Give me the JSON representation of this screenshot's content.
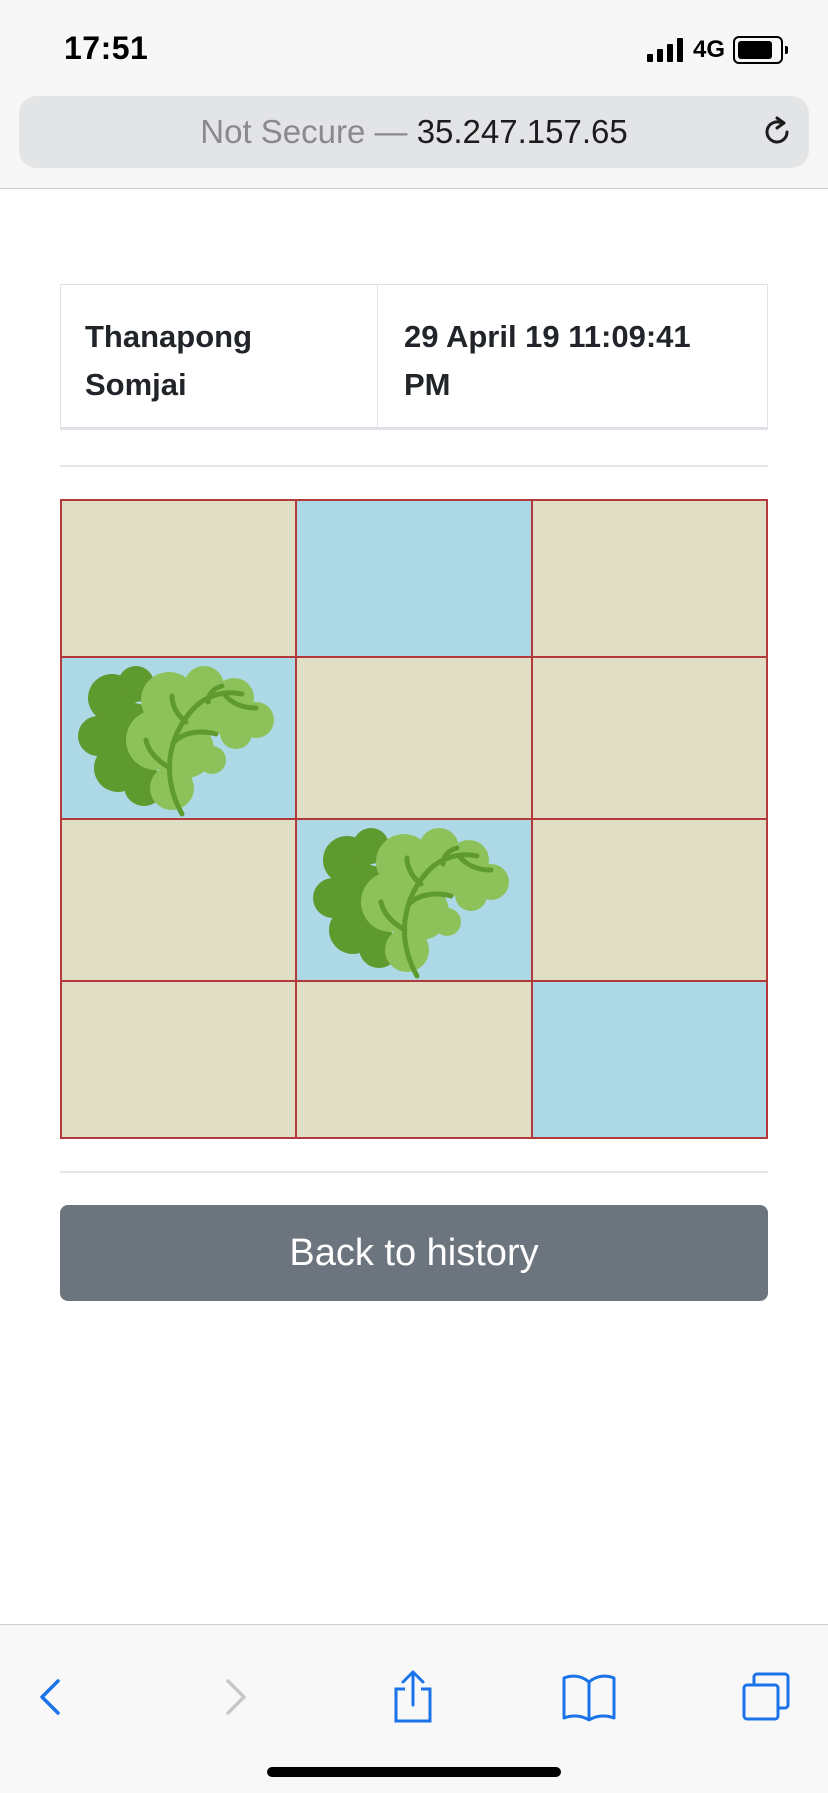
{
  "status_bar": {
    "time": "17:51",
    "network": "4G",
    "icons": [
      "signal-bars-icon",
      "battery-icon"
    ]
  },
  "browser": {
    "security_label": "Not Secure — ",
    "host": "35.247.157.65",
    "reload_icon": "reload-icon"
  },
  "record": {
    "player_name": "Thanapong Somjai",
    "timestamp": "29 April 19 11:09:41 PM"
  },
  "board": {
    "rows": 4,
    "cols": 3,
    "colors": {
      "land": "#e0dfc5",
      "water": "#add8e6",
      "border": "#b23a3a"
    },
    "cells": [
      [
        {
          "tile": "land",
          "item": null
        },
        {
          "tile": "water",
          "item": null
        },
        {
          "tile": "land",
          "item": null
        }
      ],
      [
        {
          "tile": "water",
          "item": "lettuce-icon"
        },
        {
          "tile": "land",
          "item": null
        },
        {
          "tile": "land",
          "item": null
        }
      ],
      [
        {
          "tile": "land",
          "item": null
        },
        {
          "tile": "water",
          "item": "lettuce-icon"
        },
        {
          "tile": "land",
          "item": null
        }
      ],
      [
        {
          "tile": "land",
          "item": null
        },
        {
          "tile": "land",
          "item": null
        },
        {
          "tile": "water",
          "item": null
        }
      ]
    ]
  },
  "actions": {
    "back_label": "Back to history",
    "button_color": "#6c757d"
  },
  "toolbar": {
    "items": [
      "back-icon",
      "forward-icon",
      "share-icon",
      "bookmarks-icon",
      "tabs-icon"
    ],
    "accent": "#1a73e8"
  }
}
